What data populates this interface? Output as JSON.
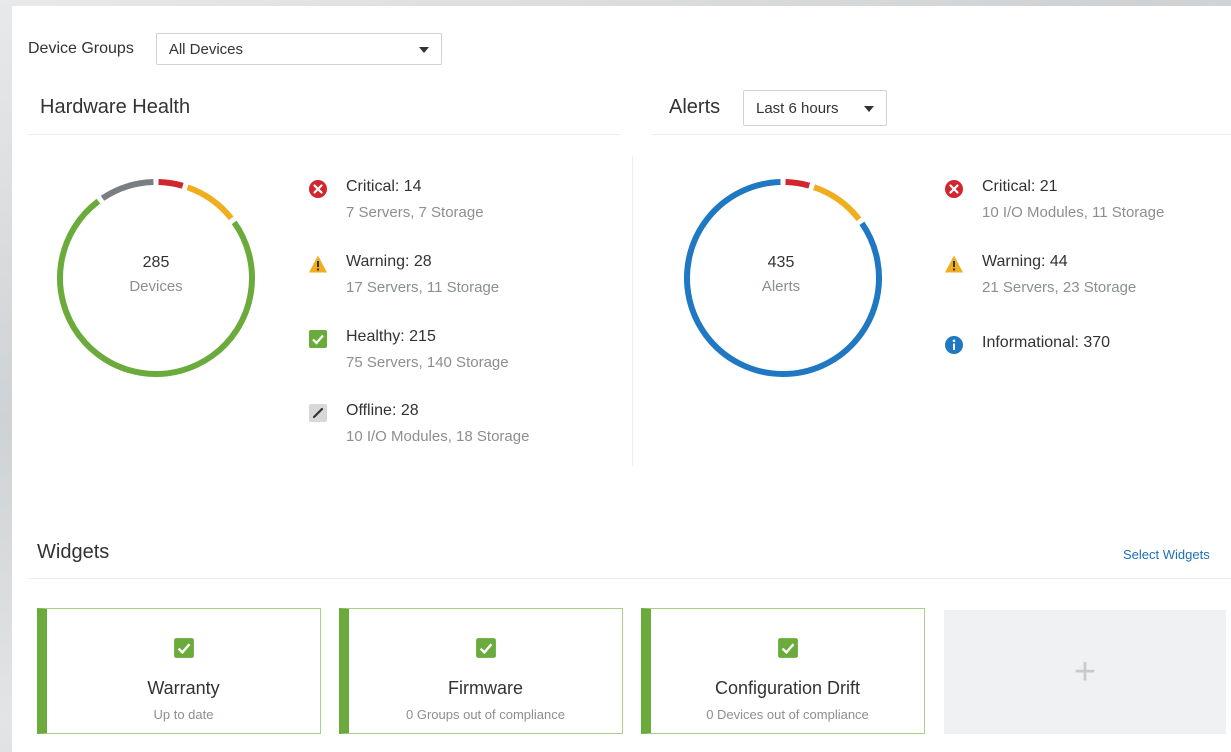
{
  "device_groups": {
    "label": "Device Groups",
    "selected": "All Devices"
  },
  "hardware_health": {
    "title": "Hardware Health",
    "total": "285",
    "total_label": "Devices",
    "items": [
      {
        "title": "Critical: 14",
        "sub": "7 Servers, 7 Storage",
        "icon": "critical-icon"
      },
      {
        "title": "Warning: 28",
        "sub": "17 Servers, 11 Storage",
        "icon": "warning-icon"
      },
      {
        "title": "Healthy: 215",
        "sub": "75 Servers, 140 Storage",
        "icon": "healthy-icon"
      },
      {
        "title": "Offline: 28",
        "sub": "10 I/O Modules, 18 Storage",
        "icon": "offline-icon"
      }
    ],
    "segments": [
      {
        "name": "Critical",
        "value": 14,
        "color": "#d2262e"
      },
      {
        "name": "Warning",
        "value": 28,
        "color": "#f0ae1f"
      },
      {
        "name": "Healthy",
        "value": 215,
        "color": "#6aab3b"
      },
      {
        "name": "Offline",
        "value": 28,
        "color": "#7a7e81"
      }
    ]
  },
  "alerts": {
    "title": "Alerts",
    "range": "Last 6 hours",
    "total": "435",
    "total_label": "Alerts",
    "items": [
      {
        "title": "Critical: 21",
        "sub": "10 I/O Modules, 11 Storage",
        "icon": "critical-icon"
      },
      {
        "title": "Warning: 44",
        "sub": "21 Servers, 23 Storage",
        "icon": "warning-icon"
      },
      {
        "title": "Informational: 370",
        "sub": "",
        "icon": "info-icon"
      }
    ],
    "segments": [
      {
        "name": "Critical",
        "value": 21,
        "color": "#d2262e"
      },
      {
        "name": "Warning",
        "value": 44,
        "color": "#f0ae1f"
      },
      {
        "name": "Informational",
        "value": 370,
        "color": "#1f78c1"
      }
    ]
  },
  "widgets": {
    "title": "Widgets",
    "select_link": "Select Widgets",
    "cards": [
      {
        "title": "Warranty",
        "sub": "Up to date"
      },
      {
        "title": "Firmware",
        "sub": "0 Groups out of compliance"
      },
      {
        "title": "Configuration Drift",
        "sub": "0 Devices out of compliance"
      }
    ],
    "add_symbol": "+"
  },
  "colors": {
    "critical": "#d2262e",
    "warning": "#f0ae1f",
    "healthy": "#6aab3b",
    "offline": "#7a7e81",
    "info": "#1f78c1",
    "link": "#1f6fb5"
  }
}
